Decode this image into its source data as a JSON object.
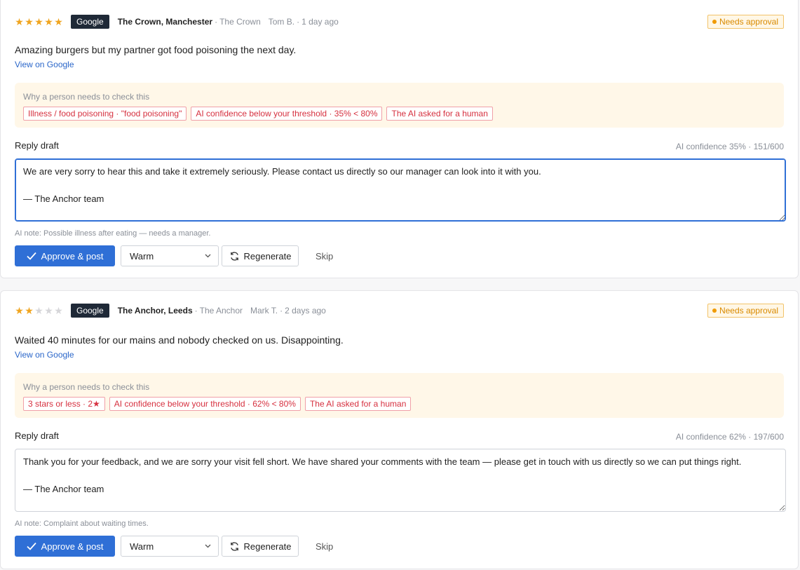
{
  "reviews": [
    {
      "rating": 5,
      "stars_on": 5,
      "source": "Google",
      "business": "The Crown, Manchester",
      "venue": "The Crown",
      "author": "Tom B.",
      "time": "1 day ago",
      "status": "Needs approval",
      "text": "Amazing burgers but my partner got food poisoning the next day.",
      "link_label": "View on Google",
      "why_title": "Why a person needs to check this",
      "reasons": [
        "Illness / food poisoning · \"food poisoning\"",
        "AI confidence below your threshold · 35% < 80%",
        "The AI asked for a human"
      ],
      "reply_label": "Reply draft",
      "confidence": "AI confidence 35% · 151/600",
      "draft": "We are very sorry to hear this and take it extremely seriously. Please contact us directly so our manager can look into it with you.\n\n— The Anchor team",
      "note": "AI note: Possible illness after eating — needs a manager.",
      "approve_label": "Approve & post",
      "tone": "Warm",
      "regenerate_label": "Regenerate",
      "skip_label": "Skip"
    },
    {
      "rating": 2,
      "stars_on": 2,
      "source": "Google",
      "business": "The Anchor, Leeds",
      "venue": "The Anchor",
      "author": "Mark T.",
      "time": "2 days ago",
      "status": "Needs approval",
      "text": "Waited 40 minutes for our mains and nobody checked on us. Disappointing.",
      "link_label": "View on Google",
      "why_title": "Why a person needs to check this",
      "reasons": [
        "3 stars or less · 2★",
        "AI confidence below your threshold · 62% < 80%",
        "The AI asked for a human"
      ],
      "reply_label": "Reply draft",
      "confidence": "AI confidence 62% · 197/600",
      "draft": "Thank you for your feedback, and we are sorry your visit fell short. We have shared your comments with the team — please get in touch with us directly so we can put things right.\n\n— The Anchor team",
      "note": "AI note: Complaint about waiting times.",
      "approve_label": "Approve & post",
      "tone": "Warm",
      "regenerate_label": "Regenerate",
      "skip_label": "Skip"
    }
  ],
  "colors": {
    "accent": "#2f6fd6",
    "star": "#f0a520",
    "warning": "#d98a00",
    "danger": "#d6303f"
  }
}
